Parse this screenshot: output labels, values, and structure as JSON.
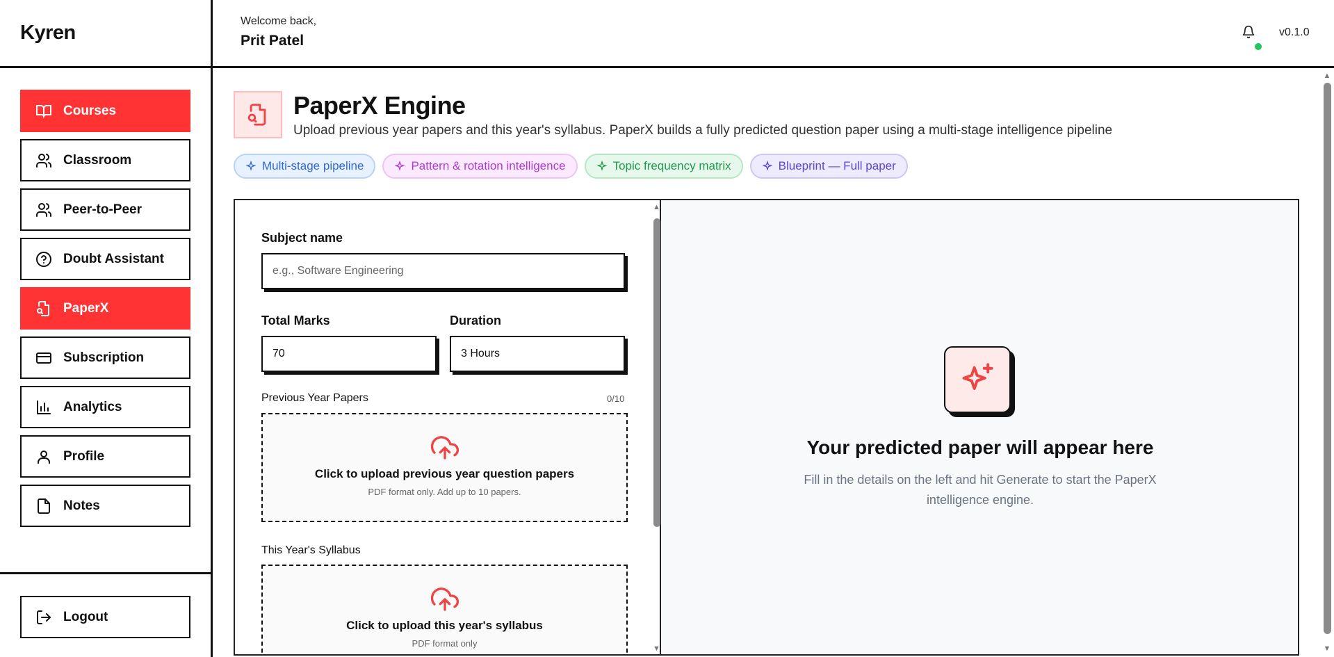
{
  "brand": "Kyren",
  "sidebar": {
    "items": [
      {
        "label": "Courses",
        "icon": "book-open-icon",
        "active": true
      },
      {
        "label": "Classroom",
        "icon": "users-icon",
        "active": false
      },
      {
        "label": "Peer-to-Peer",
        "icon": "users-icon",
        "active": false
      },
      {
        "label": "Doubt Assistant",
        "icon": "help-circle-icon",
        "active": false
      },
      {
        "label": "PaperX",
        "icon": "file-search-icon",
        "active": true
      },
      {
        "label": "Subscription",
        "icon": "credit-card-icon",
        "active": false
      },
      {
        "label": "Analytics",
        "icon": "bar-chart-icon",
        "active": false
      },
      {
        "label": "Profile",
        "icon": "user-icon",
        "active": false
      },
      {
        "label": "Notes",
        "icon": "file-icon",
        "active": false
      }
    ],
    "logout_label": "Logout"
  },
  "header": {
    "welcome": "Welcome back,",
    "username": "Prit Patel",
    "version": "v0.1.0",
    "status_color": "#22c55e"
  },
  "page": {
    "title": "PaperX Engine",
    "subtitle": "Upload previous year papers and this year's syllabus. PaperX builds a fully predicted question paper using a multi-stage intelligence pipeline",
    "chips": [
      "Multi-stage pipeline",
      "Pattern & rotation intelligence",
      "Topic frequency matrix",
      "Blueprint — Full paper"
    ]
  },
  "form": {
    "subject_label": "Subject name",
    "subject_placeholder": "e.g., Software Engineering",
    "marks_label": "Total Marks",
    "marks_value": "70",
    "duration_label": "Duration",
    "duration_value": "3 Hours",
    "papers_label": "Previous Year Papers",
    "papers_count": "0/10",
    "papers_upload_title": "Click to upload previous year question papers",
    "papers_upload_note": "PDF format only. Add up to 10 papers.",
    "syllabus_label": "This Year's Syllabus",
    "syllabus_upload_title": "Click to upload this year's syllabus",
    "syllabus_upload_note": "PDF format only"
  },
  "preview": {
    "title": "Your predicted paper will appear here",
    "text": "Fill in the details on the left and hit Generate to start the PaperX intelligence engine."
  },
  "colors": {
    "accent": "#ff3333",
    "border": "#111111"
  }
}
